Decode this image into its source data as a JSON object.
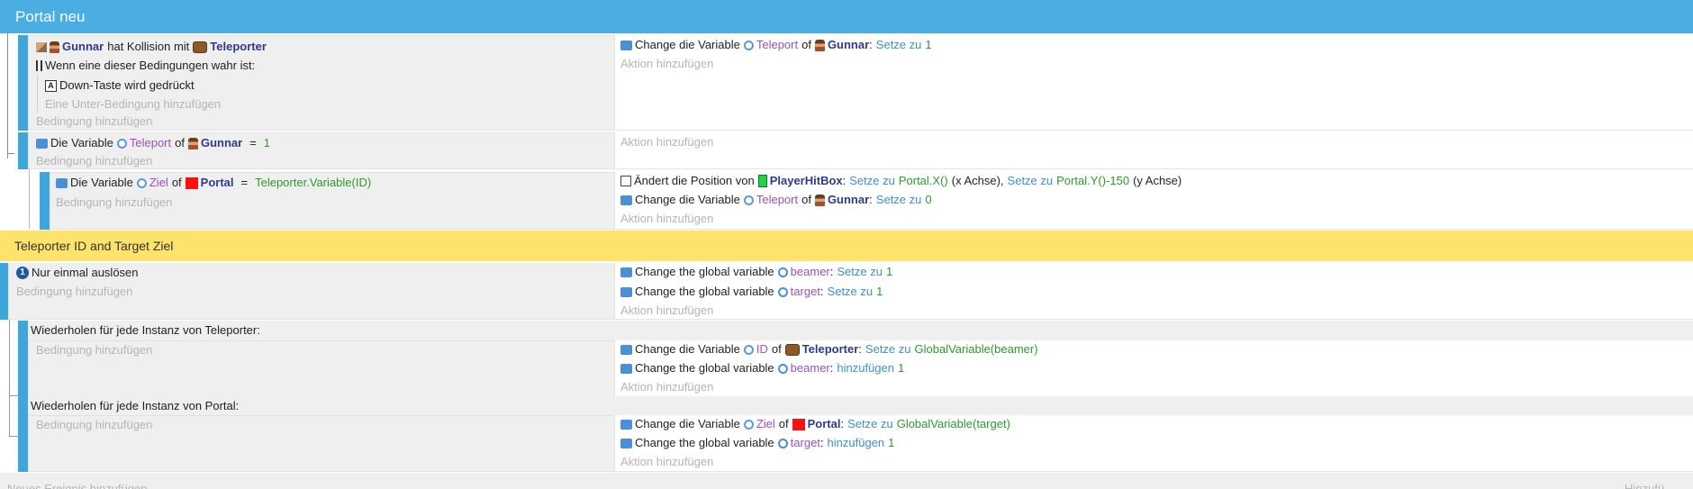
{
  "group": {
    "title": "Portal neu"
  },
  "hints": {
    "add_condition": "Bedingung hinzufügen",
    "add_subcondition": "Eine Unter-Bedingung hinzufügen",
    "add_action": "Aktion hinzufügen"
  },
  "event1": {
    "cond_object": "Gunnar",
    "cond_text": "hat Kollision mit",
    "cond_target": "Teleporter",
    "or_text": "Wenn eine dieser Bedingungen wahr ist:",
    "key_text": "Down-Taste wird gedrückt",
    "action": {
      "prefix": "Change die Variable",
      "var": "Teleport",
      "of": "of",
      "object": "Gunnar",
      "op": "Setze zu",
      "value": "1"
    }
  },
  "event2": {
    "cond_prefix": "Die Variable",
    "cond_var": "Teleport",
    "cond_of": "of",
    "cond_object": "Gunnar",
    "cond_eq": "=",
    "cond_value": "1"
  },
  "event3": {
    "cond_prefix": "Die Variable",
    "cond_var": "Ziel",
    "cond_of": "of",
    "cond_object": "Portal",
    "cond_eq": "=",
    "cond_value": "Teleporter.Variable(ID)",
    "action1": {
      "prefix": "Ändert die Position von",
      "object": "PlayerHitBox",
      "op1": "Setze zu",
      "val1": "Portal.X()",
      "axis1": "(x Achse),",
      "op2": "Setze zu",
      "val2": "Portal.Y()-150",
      "axis2": "(y Achse)"
    },
    "action2": {
      "prefix": "Change die Variable",
      "var": "Teleport",
      "of": "of",
      "object": "Gunnar",
      "op": "Setze zu",
      "value": "0"
    }
  },
  "comment": {
    "text": "Teleporter ID and Target Ziel"
  },
  "event4": {
    "cond_text": "Nur einmal auslösen",
    "action1": {
      "prefix": "Change the global variable",
      "var": "beamer",
      "op": "Setze zu",
      "value": "1"
    },
    "action2": {
      "prefix": "Change the global variable",
      "var": "target",
      "op": "Setze zu",
      "value": "1"
    }
  },
  "event5": {
    "header": "Wiederholen für jede Instanz von Teleporter:",
    "action1": {
      "prefix": "Change die Variable",
      "var": "ID",
      "of": "of",
      "object": "Teleporter",
      "op": "Setze zu",
      "value": "GlobalVariable(beamer)"
    },
    "action2": {
      "prefix": "Change the global variable",
      "var": "beamer",
      "op": "hinzufügen",
      "value": "1"
    }
  },
  "event6": {
    "header": "Wiederholen für jede Instanz von Portal:",
    "action1": {
      "prefix": "Change die Variable",
      "var": "Ziel",
      "of": "of",
      "object": "Portal",
      "op": "Setze zu",
      "value": "GlobalVariable(target)"
    },
    "action2": {
      "prefix": "Change the global variable",
      "var": "target",
      "op": "hinzufügen",
      "value": "1"
    }
  },
  "footer": {
    "left": "Neues Ereignis hinzufügen",
    "right": "Hinzufü"
  },
  "icons": {
    "variable": "variable-icon",
    "global_variable": "global-variable-icon",
    "collision": "collision-icon",
    "once": "trigger-once-icon",
    "key": "key-icon",
    "position": "position-icon"
  },
  "colors": {
    "group_header": "#4aaee2",
    "comment": "#fde36c",
    "event_bar": "#3fa6dc"
  }
}
